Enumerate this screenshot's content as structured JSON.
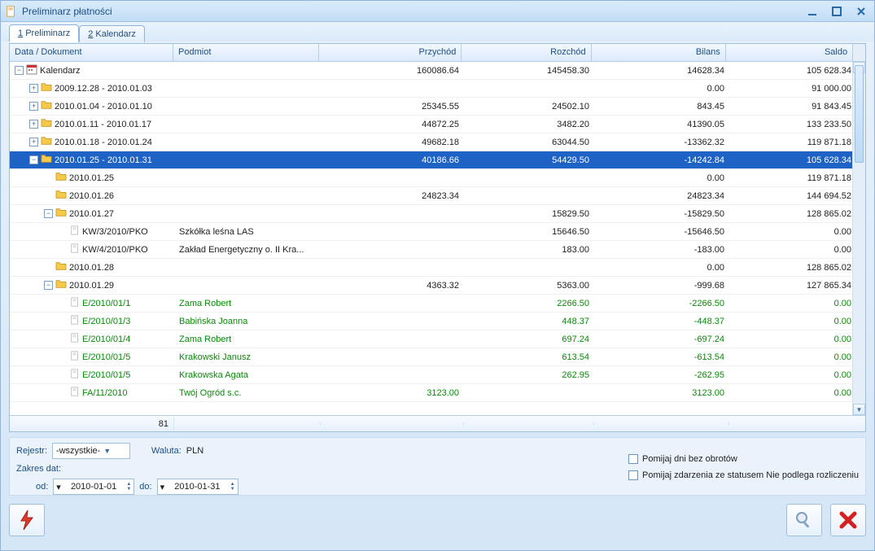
{
  "window": {
    "title": "Preliminarz płatności"
  },
  "tabs": [
    {
      "key": "1",
      "label": "Preliminarz",
      "active": true
    },
    {
      "key": "2",
      "label": "Kalendarz",
      "active": false
    }
  ],
  "columns": {
    "doc": "Data / Dokument",
    "podmiot": "Podmiot",
    "przychod": "Przychód",
    "rozchod": "Rozchód",
    "bilans": "Bilans",
    "saldo": "Saldo"
  },
  "rows": [
    {
      "level": 0,
      "expander": "-",
      "icon": "cal",
      "doc": "Kalendarz",
      "podmiot": "",
      "przychod": "160086.64",
      "rozchod": "145458.30",
      "bilans": "14628.34",
      "saldo": "105 628.34",
      "style": ""
    },
    {
      "level": 1,
      "expander": "+",
      "icon": "folder",
      "doc": "2009.12.28 - 2010.01.03",
      "podmiot": "",
      "przychod": "",
      "rozchod": "",
      "bilans": "0.00",
      "saldo": "91 000.00",
      "style": ""
    },
    {
      "level": 1,
      "expander": "+",
      "icon": "folder",
      "doc": "2010.01.04 - 2010.01.10",
      "podmiot": "",
      "przychod": "25345.55",
      "rozchod": "24502.10",
      "bilans": "843.45",
      "saldo": "91 843.45",
      "style": ""
    },
    {
      "level": 1,
      "expander": "+",
      "icon": "folder",
      "doc": "2010.01.11 - 2010.01.17",
      "podmiot": "",
      "przychod": "44872.25",
      "rozchod": "3482.20",
      "bilans": "41390.05",
      "saldo": "133 233.50",
      "style": ""
    },
    {
      "level": 1,
      "expander": "+",
      "icon": "folder",
      "doc": "2010.01.18 - 2010.01.24",
      "podmiot": "",
      "przychod": "49682.18",
      "rozchod": "63044.50",
      "bilans": "-13362.32",
      "saldo": "119 871.18",
      "style": ""
    },
    {
      "level": 1,
      "expander": "-",
      "icon": "folder",
      "doc": "2010.01.25 - 2010.01.31",
      "podmiot": "",
      "przychod": "40186.66",
      "rozchod": "54429.50",
      "bilans": "-14242.84",
      "saldo": "105 628.34",
      "style": "selected"
    },
    {
      "level": 2,
      "expander": "",
      "icon": "folder",
      "doc": "2010.01.25",
      "podmiot": "",
      "przychod": "",
      "rozchod": "",
      "bilans": "0.00",
      "saldo": "119 871.18",
      "style": ""
    },
    {
      "level": 2,
      "expander": "",
      "icon": "folder",
      "doc": "2010.01.26",
      "podmiot": "",
      "przychod": "24823.34",
      "rozchod": "",
      "bilans": "24823.34",
      "saldo": "144 694.52",
      "style": ""
    },
    {
      "level": 2,
      "expander": "-",
      "icon": "folder",
      "doc": "2010.01.27",
      "podmiot": "",
      "przychod": "",
      "rozchod": "15829.50",
      "bilans": "-15829.50",
      "saldo": "128 865.02",
      "style": ""
    },
    {
      "level": 3,
      "expander": "",
      "icon": "doc",
      "doc": "KW/3/2010/PKO",
      "podmiot": "Szkółka leśna LAS",
      "przychod": "",
      "rozchod": "15646.50",
      "bilans": "-15646.50",
      "saldo": "0.00",
      "style": ""
    },
    {
      "level": 3,
      "expander": "",
      "icon": "doc",
      "doc": "KW/4/2010/PKO",
      "podmiot": "Zakład Energetyczny o. II Kra...",
      "przychod": "",
      "rozchod": "183.00",
      "bilans": "-183.00",
      "saldo": "0.00",
      "style": ""
    },
    {
      "level": 2,
      "expander": "",
      "icon": "folder",
      "doc": "2010.01.28",
      "podmiot": "",
      "przychod": "",
      "rozchod": "",
      "bilans": "0.00",
      "saldo": "128 865.02",
      "style": ""
    },
    {
      "level": 2,
      "expander": "-",
      "icon": "folder",
      "doc": "2010.01.29",
      "podmiot": "",
      "przychod": "4363.32",
      "rozchod": "5363.00",
      "bilans": "-999.68",
      "saldo": "127 865.34",
      "style": ""
    },
    {
      "level": 3,
      "expander": "",
      "icon": "doc",
      "doc": "E/2010/01/1",
      "podmiot": "Zama Robert",
      "przychod": "",
      "rozchod": "2266.50",
      "bilans": "-2266.50",
      "saldo": "0.00",
      "style": "green"
    },
    {
      "level": 3,
      "expander": "",
      "icon": "doc",
      "doc": "E/2010/01/3",
      "podmiot": "Babińska Joanna",
      "przychod": "",
      "rozchod": "448.37",
      "bilans": "-448.37",
      "saldo": "0.00",
      "style": "green"
    },
    {
      "level": 3,
      "expander": "",
      "icon": "doc",
      "doc": "E/2010/01/4",
      "podmiot": "Zama Robert",
      "przychod": "",
      "rozchod": "697.24",
      "bilans": "-697.24",
      "saldo": "0.00",
      "style": "green"
    },
    {
      "level": 3,
      "expander": "",
      "icon": "doc",
      "doc": "E/2010/01/5",
      "podmiot": "Krakowski Janusz",
      "przychod": "",
      "rozchod": "613.54",
      "bilans": "-613.54",
      "saldo": "0.00",
      "style": "green"
    },
    {
      "level": 3,
      "expander": "",
      "icon": "doc",
      "doc": "E/2010/01/5",
      "podmiot": "Krakowska Agata",
      "przychod": "",
      "rozchod": "262.95",
      "bilans": "-262.95",
      "saldo": "0.00",
      "style": "green"
    },
    {
      "level": 3,
      "expander": "",
      "icon": "doc",
      "doc": "FA/11/2010",
      "podmiot": "Twój Ogród s.c.",
      "przychod": "3123.00",
      "rozchod": "",
      "bilans": "3123.00",
      "saldo": "0.00",
      "style": "green"
    }
  ],
  "footer": {
    "count": "81"
  },
  "controls": {
    "rejestr_label": "Rejestr:",
    "rejestr_value": "-wszystkie-",
    "waluta_label": "Waluta:",
    "waluta_value": "PLN",
    "zakres_label": "Zakres dat:",
    "od_label": "od:",
    "od_value": "2010-01-01",
    "do_label": "do:",
    "do_value": "2010-01-31",
    "chk1": "Pomijaj dni bez obrotów",
    "chk2": "Pomijaj zdarzenia ze statusem Nie podlega rozliczeniu"
  }
}
